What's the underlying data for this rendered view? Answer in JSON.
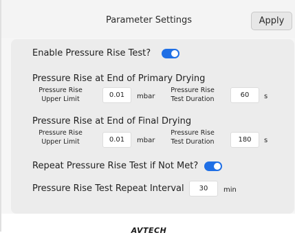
{
  "header": {
    "title": "Parameter Settings",
    "apply_label": "Apply"
  },
  "settings": {
    "enable_label": "Enable Pressure Rise Test?",
    "enable_on": true,
    "primary": {
      "heading": "Pressure Rise at End of Primary Drying",
      "upper_limit_label_1": "Pressure Rise",
      "upper_limit_label_2": "Upper Limit",
      "upper_limit_value": "0.01",
      "upper_limit_unit": "mbar",
      "duration_label_1": "Pressure Rise",
      "duration_label_2": "Test Duration",
      "duration_value": "60",
      "duration_unit": "s"
    },
    "final": {
      "heading": "Pressure Rise at End of Final Drying",
      "upper_limit_label_1": "Pressure Rise",
      "upper_limit_label_2": "Upper Limit",
      "upper_limit_value": "0.01",
      "upper_limit_unit": "mbar",
      "duration_label_1": "Pressure Rise",
      "duration_label_2": "Test Duration",
      "duration_value": "180",
      "duration_unit": "s"
    },
    "repeat_label": "Repeat Pressure Rise Test if Not Met?",
    "repeat_on": true,
    "interval_label": "Pressure Rise Test Repeat Interval",
    "interval_value": "30",
    "interval_unit": "min"
  },
  "footer": {
    "logo_text": "AVTECH"
  },
  "colors": {
    "accent": "#1f6fe5",
    "panel": "#ececec",
    "background": "#f6f6f6"
  }
}
